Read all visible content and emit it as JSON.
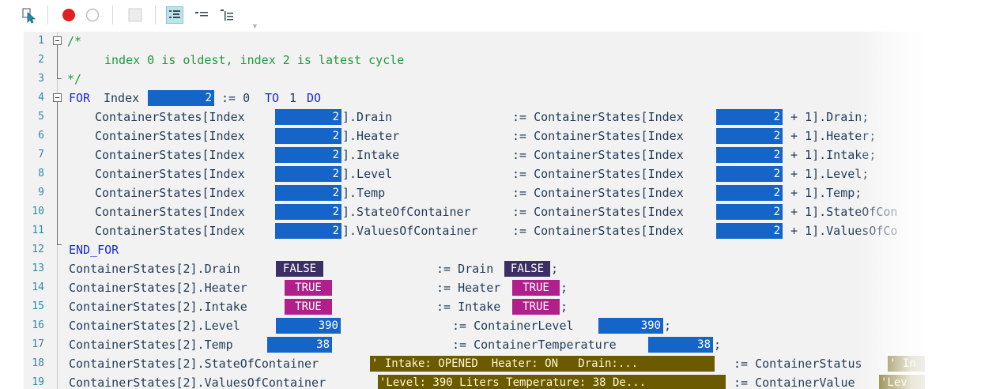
{
  "toolbar": {
    "icons": [
      "select-pointer-icon",
      "breakpoint-red-icon",
      "breakpoint-empty-icon",
      "blank-toggle-icon",
      "flow-control-icon",
      "show-values-icon",
      "outline-icon"
    ],
    "colors": {
      "active_bg": "#bde4ea",
      "breakpoint": "#e02020"
    }
  },
  "editor": {
    "line_numbers": [
      "1",
      "2",
      "3",
      "4",
      "5",
      "6",
      "7",
      "8",
      "9",
      "10",
      "11",
      "12",
      "13",
      "14",
      "15",
      "16",
      "17",
      "18",
      "19"
    ],
    "lines": {
      "l1": "/*",
      "l2": "index 0 is oldest, index 2 is latest cycle",
      "l3": "*/",
      "l4_kw1": "FOR",
      "l4_var": "Index",
      "l4_assign": ":= 0",
      "l4_to": "TO",
      "l4_one": "1",
      "l4_do": "DO",
      "l12": "END_FOR"
    },
    "loop_rows": [
      {
        "lhs_prefix": "ContainerStates[Index",
        "lhs_suffix": "].Drain",
        "rhs_prefix": ":= ContainerStates[Index",
        "rhs_suffix": "+ 1].Drain;"
      },
      {
        "lhs_prefix": "ContainerStates[Index",
        "lhs_suffix": "].Heater",
        "rhs_prefix": ":= ContainerStates[Index",
        "rhs_suffix": "+ 1].Heater;"
      },
      {
        "lhs_prefix": "ContainerStates[Index",
        "lhs_suffix": "].Intake",
        "rhs_prefix": ":= ContainerStates[Index",
        "rhs_suffix": "+ 1].Intake;"
      },
      {
        "lhs_prefix": "ContainerStates[Index",
        "lhs_suffix": "].Level",
        "rhs_prefix": ":= ContainerStates[Index",
        "rhs_suffix": "+ 1].Level;"
      },
      {
        "lhs_prefix": "ContainerStates[Index",
        "lhs_suffix": "].Temp",
        "rhs_prefix": ":= ContainerStates[Index",
        "rhs_suffix": "+ 1].Temp;"
      },
      {
        "lhs_prefix": "ContainerStates[Index",
        "lhs_suffix": "].StateOfContainer",
        "rhs_prefix": ":= ContainerStates[Index",
        "rhs_suffix": "+ 1].StateOfCon"
      },
      {
        "lhs_prefix": "ContainerStates[Index",
        "lhs_suffix": "].ValuesOfContainer",
        "rhs_prefix": ":= ContainerStates[Index",
        "rhs_suffix": "+ 1].ValuesOfCo"
      }
    ],
    "index_value": "2",
    "assign_rows": [
      {
        "lhs": "ContainerStates[2].Drain",
        "lhs_val": "FALSE",
        "rhs": ":= Drain",
        "rhs_val": "FALSE",
        "end": ";"
      },
      {
        "lhs": "ContainerStates[2].Heater",
        "lhs_val": "TRUE",
        "rhs": ":= Heater",
        "rhs_val": "TRUE",
        "end": ";"
      },
      {
        "lhs": "ContainerStates[2].Intake",
        "lhs_val": "TRUE",
        "rhs": ":= Intake",
        "rhs_val": "TRUE",
        "end": ";"
      },
      {
        "lhs": "ContainerStates[2].Level",
        "lhs_val": "390",
        "rhs": ":= ContainerLevel",
        "rhs_val": "390",
        "end": ";"
      },
      {
        "lhs": "ContainerStates[2].Temp",
        "lhs_val": "38",
        "rhs": ":= ContainerTemperature",
        "rhs_val": "38",
        "end": ";"
      },
      {
        "lhs": "ContainerStates[2].StateOfContainer",
        "lhs_val": "' Intake: OPENED  Heater: ON   Drain:...",
        "rhs": ":= ContainerStatus",
        "rhs_val": "' In"
      },
      {
        "lhs": "ContainerStates[2].ValuesOfContainer",
        "lhs_val": "'Level: 390 Liters Temperature: 38 De...",
        "rhs": ":= ContainerValue",
        "rhs_val": "'Lev"
      }
    ],
    "colors": {
      "background": "#f2f2f2",
      "comment": "#1f9a3a",
      "keyword": "#1b2bd6",
      "identifier": "#1e3b5a",
      "line_number": "#2f8aa6",
      "monitor_numeric": "#1565c9",
      "monitor_false": "#3c2f64",
      "monitor_true": "#b01f8c",
      "monitor_string": "#6b5a00"
    }
  }
}
